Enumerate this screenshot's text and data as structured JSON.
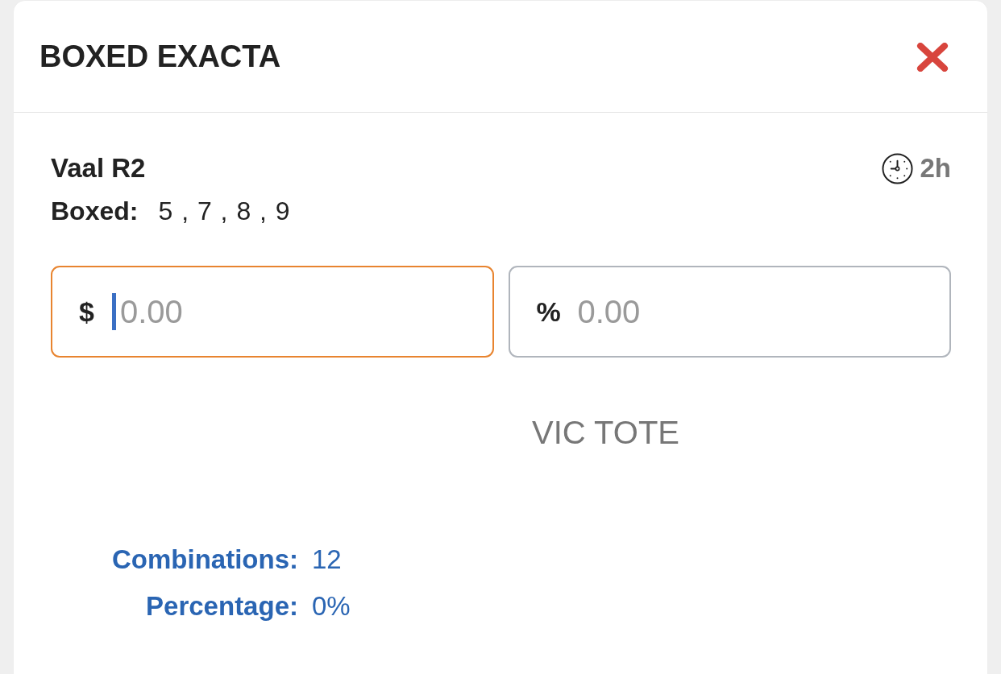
{
  "dialog": {
    "title": "BOXED EXACTA"
  },
  "race": {
    "name": "Vaal R2",
    "time": "2h",
    "boxed_label": "Boxed:",
    "boxed_runners": "5 , 7 , 8 , 9"
  },
  "fields": [
    {
      "prefix": "$",
      "placeholder": "0.00",
      "focused": true
    },
    {
      "prefix": "%",
      "placeholder": "0.00",
      "focused": false
    }
  ],
  "tote": "VIC TOTE",
  "summary": [
    {
      "label": "Combinations:",
      "value": "12"
    },
    {
      "label": "Percentage:",
      "value": "0%"
    }
  ]
}
